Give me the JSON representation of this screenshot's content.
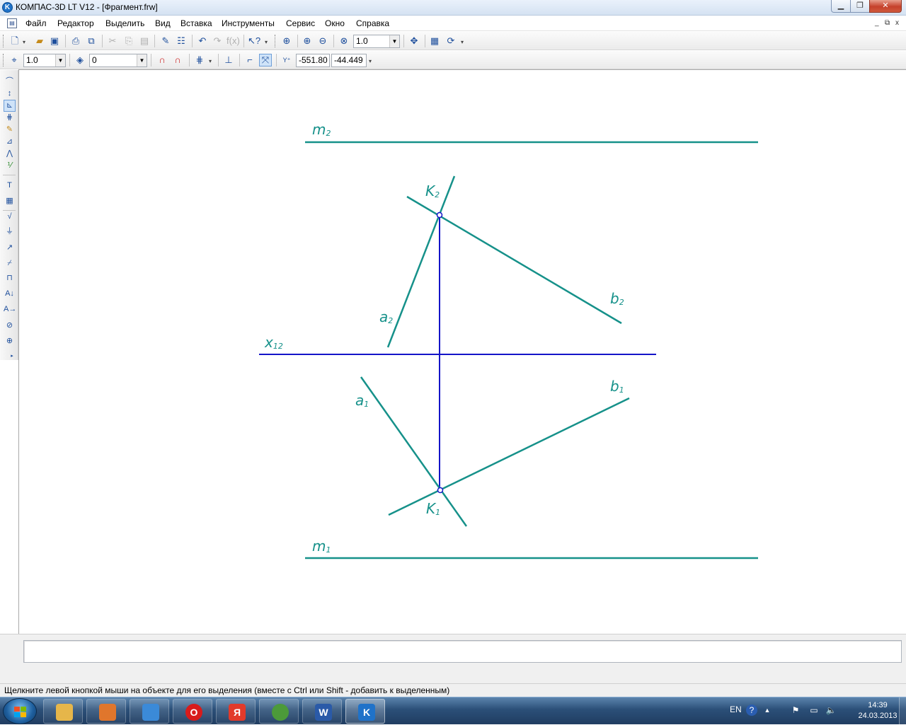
{
  "window": {
    "title": "КОМПАС-3D LT V12 - [Фрагмент.frw]",
    "app_icon": "kompas-logo-icon",
    "controls": [
      "minimize-icon",
      "maximize-icon",
      "close-icon"
    ]
  },
  "menu": {
    "items": [
      "Файл",
      "Редактор",
      "Выделить",
      "Вид",
      "Вставка",
      "Инструменты",
      "Сервис",
      "Окно",
      "Справка"
    ],
    "mdi_controls": [
      "_",
      "⧉",
      "x"
    ]
  },
  "toolbar_top": {
    "zoom_value": "1.0",
    "icons": [
      "new-document-icon",
      "open-icon",
      "save-icon",
      "print-preview-icon",
      "print-icon",
      "cut-icon",
      "copy-icon",
      "paste-icon",
      "format-brush-icon",
      "properties-icon",
      "undo-icon",
      "redo-icon",
      "function-icon",
      "help-pointer-icon",
      "zoom-window-icon",
      "zoom-in-icon",
      "zoom-out-icon",
      "zoom-scale-icon",
      "pan-icon",
      "layer-manager-icon",
      "refresh-icon"
    ]
  },
  "toolbar_current_state": {
    "step_value": "1.0",
    "layer_value": "0",
    "coord_x": "-551.80",
    "coord_y": "-44.449",
    "icons": [
      "current-step-icon",
      "layer-icon",
      "snap-magnet-icon",
      "snap-settings-icon",
      "grid-icon",
      "local-cs-icon",
      "ortho-icon",
      "snap-active-icon",
      "cursor-coords-icon"
    ]
  },
  "left_toolbar": {
    "icons": [
      "geometry-icon",
      "dimensions-icon",
      "designations-icon",
      "edit-icon",
      "parametrization-icon",
      "measure-icon",
      "selection-icon",
      "associative-views-icon",
      "text-icon",
      "table-icon",
      "roughness-icon",
      "base-icon",
      "leader-icon",
      "tolerance-icon",
      "view-arrow-icon",
      "cut-line-icon",
      "axis-icon",
      "hatch-icon",
      "center-mark-icon"
    ]
  },
  "drawing": {
    "line_color": "#16918a",
    "axis_color": "#1414c8",
    "labels": {
      "m2": {
        "letter": "m",
        "sub": "2"
      },
      "k2": {
        "letter": "K",
        "sub": "2"
      },
      "b2": {
        "letter": "b",
        "sub": "2"
      },
      "a2": {
        "letter": "a",
        "sub": "2"
      },
      "x12": {
        "letter": "x",
        "sub": "12"
      },
      "a1": {
        "letter": "a",
        "sub": "1"
      },
      "b1": {
        "letter": "b",
        "sub": "1"
      },
      "k1": {
        "letter": "K",
        "sub": "1"
      },
      "m1": {
        "letter": "m",
        "sub": "1"
      }
    }
  },
  "status": {
    "message": "Щелкните левой кнопкой мыши на объекте для его выделения (вместе с Ctrl или Shift - добавить к выделенным)"
  },
  "taskbar": {
    "apps": [
      {
        "name": "explorer-icon",
        "color": "#e6b64a"
      },
      {
        "name": "media-player-icon",
        "color": "#e0762c"
      },
      {
        "name": "mail-icon",
        "color": "#3b8ad8"
      },
      {
        "name": "opera-icon",
        "color": "#d81b1b",
        "glyph": "O"
      },
      {
        "name": "yandex-icon",
        "color": "#e23a2a",
        "glyph": "Я"
      },
      {
        "name": "chrome-icon",
        "color": "#4c9a3a"
      },
      {
        "name": "word-icon",
        "color": "#2a5aa8",
        "glyph": "W"
      },
      {
        "name": "kompas-icon",
        "color": "#1f72c9",
        "glyph": "K"
      }
    ],
    "language": "EN",
    "time": "14:39",
    "date": "24.03.2013"
  }
}
